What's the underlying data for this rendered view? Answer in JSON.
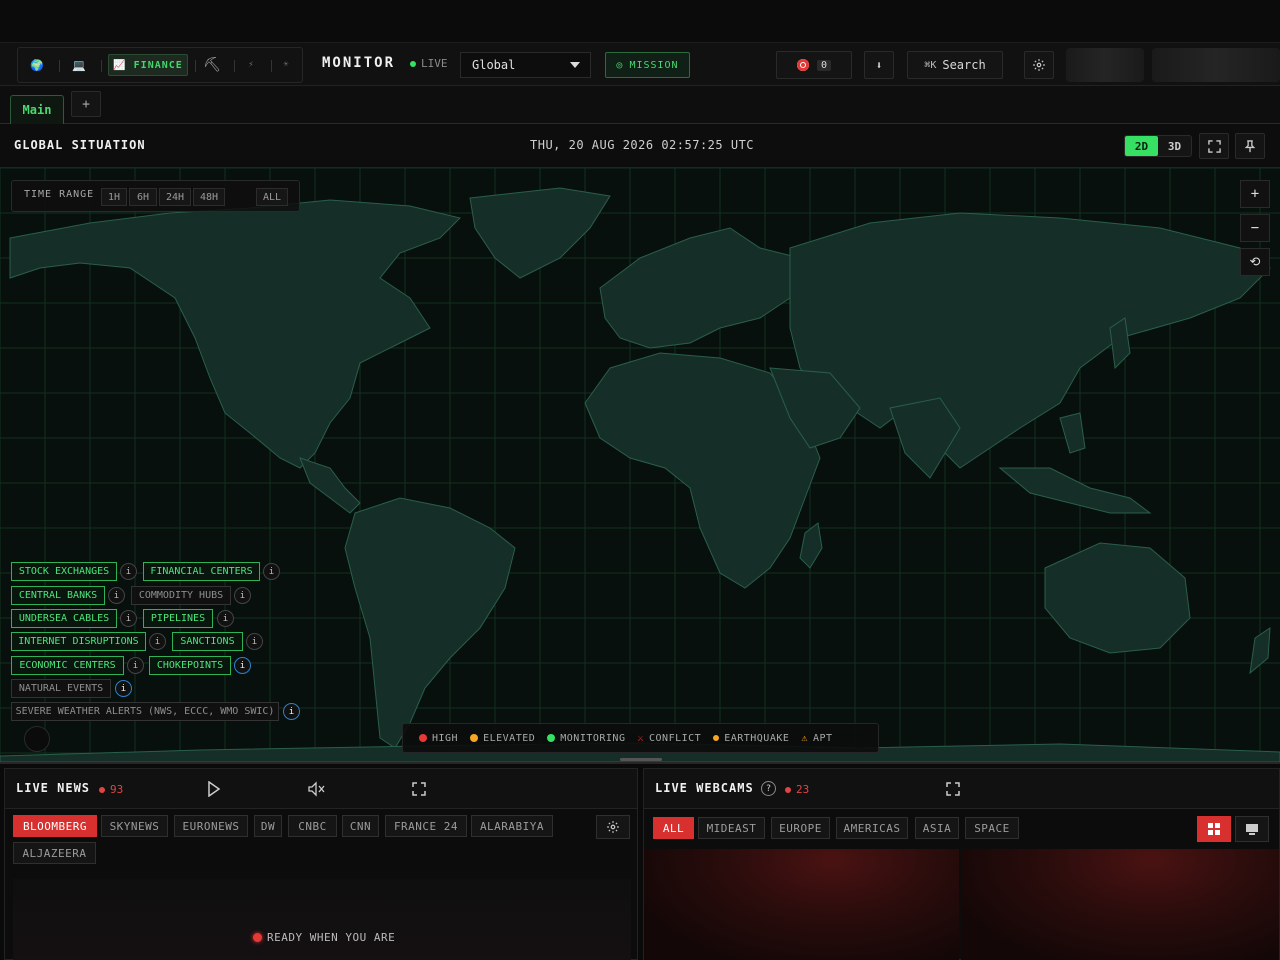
{
  "header": {
    "variants": [
      {
        "id": "world",
        "label": "🌍"
      },
      {
        "id": "tech",
        "label": "💻"
      },
      {
        "id": "finance",
        "label": "📈 FINANCE"
      },
      {
        "id": "mining",
        "label": "⛏"
      },
      {
        "id": "energy",
        "label": "⚡"
      },
      {
        "id": "happy",
        "label": "☀"
      }
    ],
    "brand": "MONITOR",
    "live_label": "LIVE",
    "region": "Global",
    "mission_label": "MISSION",
    "alerts_count": "0",
    "download_icon": "⬇",
    "search_shortcut": "⌘K",
    "search_label": "Search"
  },
  "tabs": {
    "main": "Main",
    "add": "+"
  },
  "map": {
    "title": "GLOBAL SITUATION",
    "clock": "THU, 20 AUG 2026 02:57:25 UTC",
    "view_2d": "2D",
    "view_3d": "3D",
    "time_range": {
      "label": "TIME RANGE",
      "options": [
        "1H",
        "6H",
        "24H",
        "48H",
        "ALL"
      ]
    },
    "zoom_in": "+",
    "zoom_out": "−",
    "reset": "⟲",
    "layers": [
      {
        "label": "STOCK EXCHANGES",
        "on": true
      },
      {
        "label": "FINANCIAL CENTERS",
        "on": true
      },
      {
        "label": "CENTRAL BANKS",
        "on": true
      },
      {
        "label": "COMMODITY HUBS",
        "on": false
      },
      {
        "label": "UNDERSEA CABLES",
        "on": true
      },
      {
        "label": "PIPELINES",
        "on": true
      },
      {
        "label": "INTERNET DISRUPTIONS",
        "on": true
      },
      {
        "label": "SANCTIONS",
        "on": true
      },
      {
        "label": "ECONOMIC CENTERS",
        "on": true
      },
      {
        "label": "CHOKEPOINTS",
        "on": true
      },
      {
        "label": "NATURAL EVENTS",
        "on": false
      },
      {
        "label": "SEVERE WEATHER ALERTS (NWS, ECCC, WMO SWIC)",
        "on": false
      }
    ],
    "info_glyph": "i",
    "legend": [
      {
        "label": "HIGH",
        "color": "#e53935",
        "shape": "dot"
      },
      {
        "label": "ELEVATED",
        "color": "#f5a623",
        "shape": "dot"
      },
      {
        "label": "MONITORING",
        "color": "#35e063",
        "shape": "dot"
      },
      {
        "label": "CONFLICT",
        "color": "#e53935",
        "shape": "x"
      },
      {
        "label": "EARTHQUAKE",
        "color": "#f5a623",
        "shape": "dot"
      },
      {
        "label": "APT",
        "color": "#f5a623",
        "shape": "warn"
      }
    ]
  },
  "news": {
    "title": "LIVE NEWS",
    "count": "93",
    "channels": [
      "BLOOMBERG",
      "SKYNEWS",
      "EURONEWS",
      "DW",
      "CNBC",
      "CNN",
      "FRANCE 24",
      "ALARABIYA",
      "ALJAZEERA"
    ],
    "active_channel": "BLOOMBERG",
    "status": "READY WHEN YOU ARE"
  },
  "webcams": {
    "title": "LIVE WEBCAMS",
    "help": "?",
    "count": "23",
    "regions": [
      "ALL",
      "MIDEAST",
      "EUROPE",
      "AMERICAS",
      "ASIA",
      "SPACE"
    ],
    "active_region": "ALL"
  },
  "colors": {
    "accent": "#35e063",
    "alert": "#e04545",
    "land": "#15302a",
    "ocean": "#07100c",
    "grid": "#123826"
  }
}
